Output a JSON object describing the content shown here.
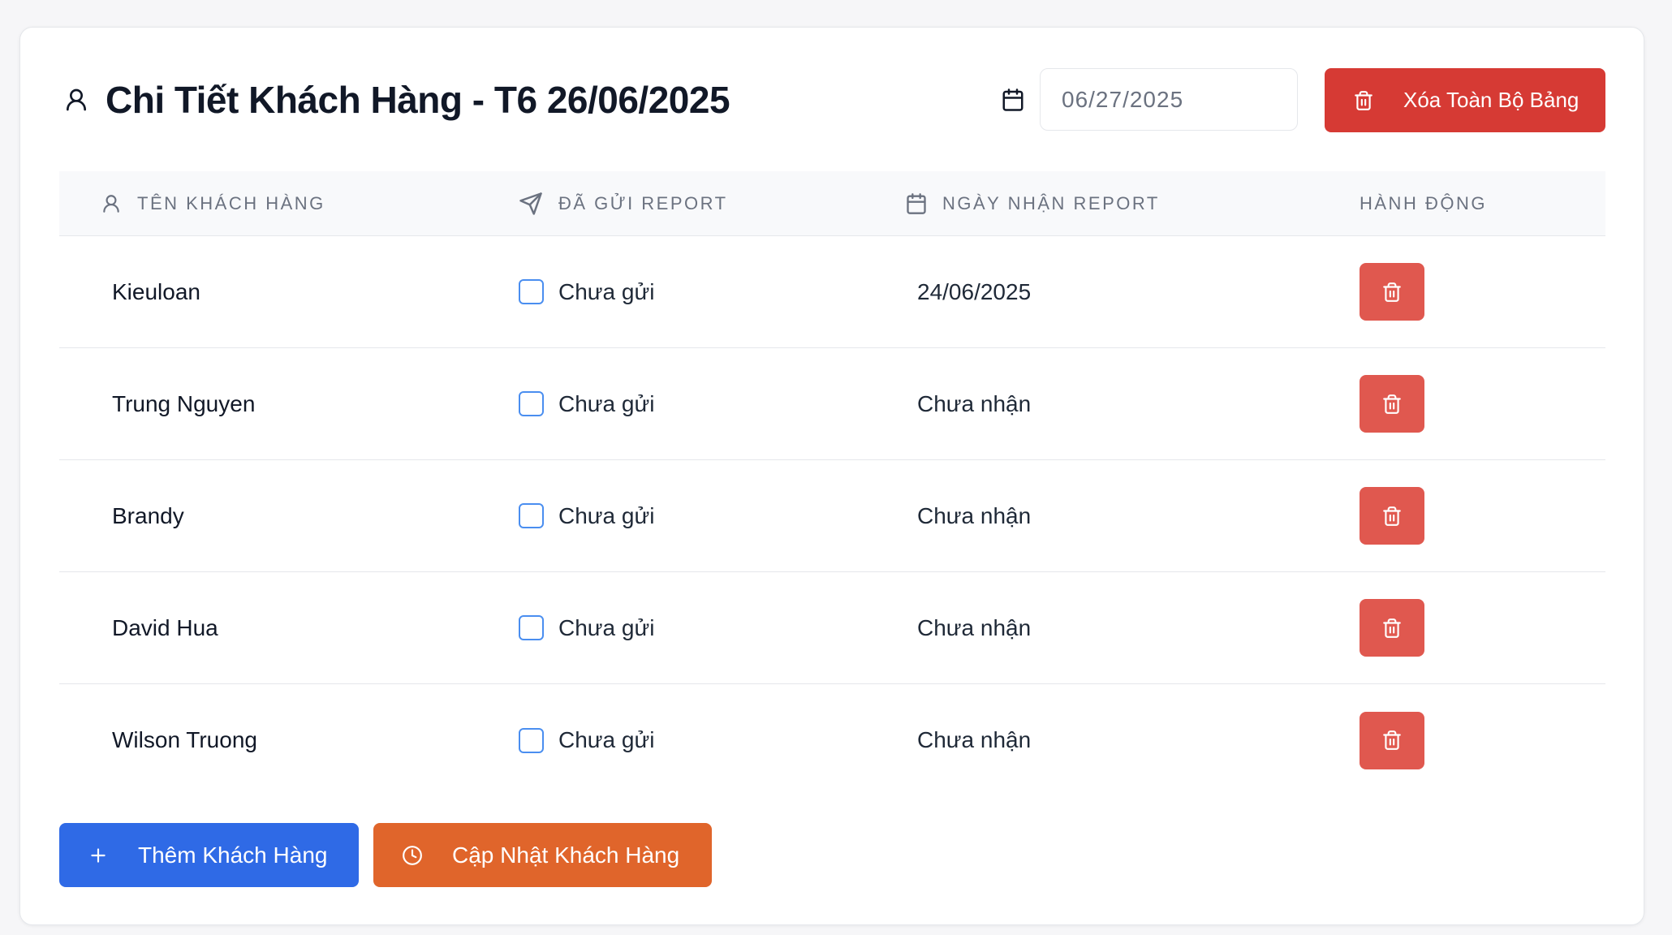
{
  "colors": {
    "page_bg": "#f6f6f8",
    "card_bg": "#ffffff",
    "text_dark": "#111827",
    "text_body": "#1f2937",
    "text_muted": "#6b7280",
    "border": "#e5e7eb",
    "header_bg": "#f8f9fb",
    "danger": "#d63a34",
    "danger_light": "#e0584f",
    "primary": "#2f6ae6",
    "warning": "#e0652b",
    "checkbox": "#4a8ef0"
  },
  "header": {
    "icon": "user-icon",
    "title": "Chi Tiết Khách Hàng - T6 26/06/2025",
    "date_icon": "calendar-icon",
    "date_value": "06/27/2025",
    "delete_all": {
      "icon": "trash-icon",
      "label": "Xóa Toàn Bộ Bảng"
    }
  },
  "table": {
    "columns": [
      {
        "label": "TÊN KHÁCH HÀNG",
        "icon": "user-icon"
      },
      {
        "label": "ĐÃ GỬI REPORT",
        "icon": "send-icon"
      },
      {
        "label": "NGÀY NHẬN REPORT",
        "icon": "calendar-icon"
      },
      {
        "label": "HÀNH ĐỘNG"
      }
    ],
    "rows": [
      {
        "name": "Kieuloan",
        "sent": false,
        "sent_label": "Chưa gửi",
        "received": "24/06/2025",
        "action_icon": "trash-icon"
      },
      {
        "name": "Trung Nguyen",
        "sent": false,
        "sent_label": "Chưa gửi",
        "received": "Chưa nhận",
        "action_icon": "trash-icon"
      },
      {
        "name": "Brandy",
        "sent": false,
        "sent_label": "Chưa gửi",
        "received": "Chưa nhận",
        "action_icon": "trash-icon"
      },
      {
        "name": "David Hua",
        "sent": false,
        "sent_label": "Chưa gửi",
        "received": "Chưa nhận",
        "action_icon": "trash-icon"
      },
      {
        "name": "Wilson Truong",
        "sent": false,
        "sent_label": "Chưa gửi",
        "received": "Chưa nhận",
        "action_icon": "trash-icon"
      }
    ]
  },
  "footer": {
    "add": {
      "icon": "plus-icon",
      "label": "Thêm Khách Hàng"
    },
    "update": {
      "icon": "clock-icon",
      "label": "Cập Nhật Khách Hàng"
    }
  }
}
